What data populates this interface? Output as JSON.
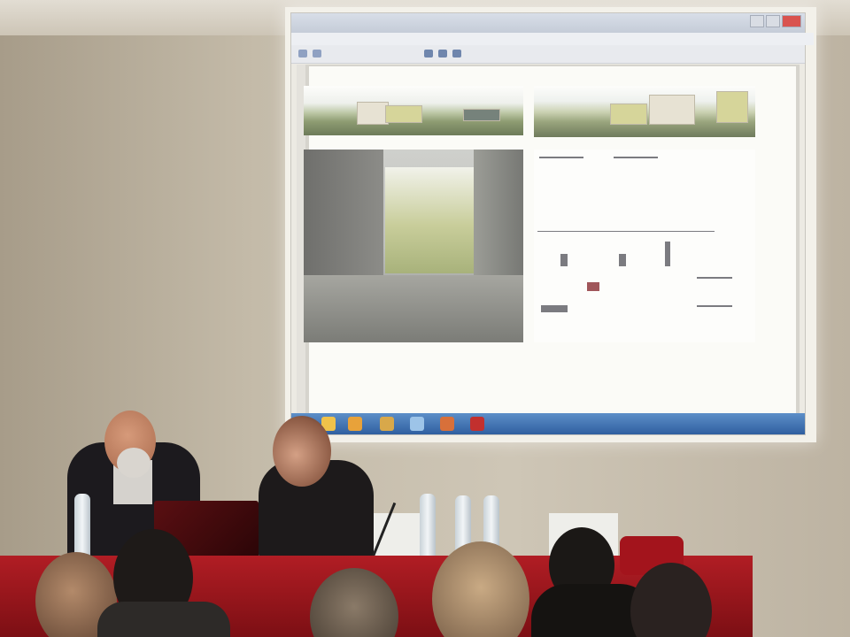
{
  "scene": {
    "description_color_wall": "#c4bba9",
    "table_color": "#a5161d"
  },
  "projected_window": {
    "title": "",
    "taskbar_clock": {
      "time": "",
      "date": ""
    }
  }
}
